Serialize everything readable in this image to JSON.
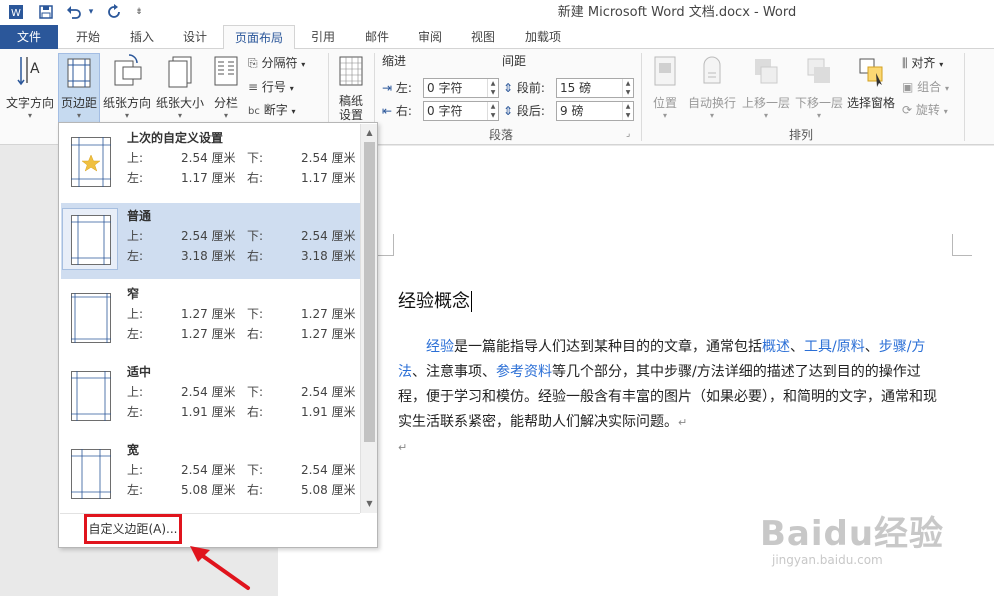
{
  "window": {
    "title": "新建 Microsoft Word 文档.docx - Word",
    "quick_access": [
      "word-icon",
      "save-icon",
      "undo-icon",
      "undo-dropdown-icon",
      "redo-icon",
      "customize-icon"
    ]
  },
  "tabs": [
    "文件",
    "开始",
    "插入",
    "设计",
    "页面布局",
    "引用",
    "邮件",
    "审阅",
    "视图",
    "加载项"
  ],
  "active_tab": "页面布局",
  "ribbon": {
    "text_direction": "文字方向",
    "margins": "页边距",
    "orientation": "纸张方向",
    "size": "纸张大小",
    "columns": "分栏",
    "breaks": "分隔符",
    "line_numbers": "行号",
    "hyphenation": "断字",
    "manuscript": "稿纸\n设置",
    "manuscript_l1": "稿纸",
    "manuscript_l2": "设置",
    "indent_label": "缩进",
    "indent_left_label": "左:",
    "indent_left_value": "0 字符",
    "indent_right_label": "右:",
    "indent_right_value": "0 字符",
    "spacing_label": "间距",
    "spacing_before_label": "段前:",
    "spacing_before_value": "15 磅",
    "spacing_after_label": "段后:",
    "spacing_after_value": "9 磅",
    "paragraph_group": "段落",
    "position": "位置",
    "wrap_text": "自动换行",
    "bring_forward": "上移一层",
    "send_backward": "下移一层",
    "selection_pane": "选择窗格",
    "align": "对齐",
    "group": "组合",
    "rotate": "旋转",
    "arrange_group": "排列"
  },
  "margin_gallery": {
    "options": [
      {
        "name": "上次的自定义设置",
        "top": "2.54 厘米",
        "bottom": "2.54 厘米",
        "left": "1.17 厘米",
        "right": "1.17 厘米",
        "selected": false
      },
      {
        "name": "普通",
        "top": "2.54 厘米",
        "bottom": "2.54 厘米",
        "left": "3.18 厘米",
        "right": "3.18 厘米",
        "selected": true
      },
      {
        "name": "窄",
        "top": "1.27 厘米",
        "bottom": "1.27 厘米",
        "left": "1.27 厘米",
        "right": "1.27 厘米",
        "selected": false
      },
      {
        "name": "适中",
        "top": "2.54 厘米",
        "bottom": "2.54 厘米",
        "left": "1.91 厘米",
        "right": "1.91 厘米",
        "selected": false
      },
      {
        "name": "宽",
        "top": "2.54 厘米",
        "bottom": "2.54 厘米",
        "left": "5.08 厘米",
        "right": "5.08 厘米",
        "selected": false
      }
    ],
    "labels": {
      "top": "上:",
      "bottom": "下:",
      "left": "左:",
      "right": "右:"
    },
    "custom_margins": "自定义边距(A)..."
  },
  "document": {
    "title": "经验概念",
    "body_parts": [
      {
        "t": "经验",
        "link": true
      },
      {
        "t": "是一篇能指导人们达到某种目的的文章，通常包括",
        "link": false
      },
      {
        "t": "概述",
        "link": true
      },
      {
        "t": "、",
        "link": false
      },
      {
        "t": "工具/原料",
        "link": true
      },
      {
        "t": "、",
        "link": false
      },
      {
        "t": "步骤/方法",
        "link": true
      },
      {
        "t": "、注意事项、",
        "link": false
      },
      {
        "t": "参考资料",
        "link": true
      },
      {
        "t": "等几个部分，其中步骤/方法详细的描述了达到目的的操作过程，便于学习和模仿。经验一般含有丰富的图片（如果必要），和简明的文字，通常和现实生活联系紧密，能帮助人们解决实际问题。",
        "link": false
      }
    ],
    "paragraph_mark": "↵"
  },
  "watermark": {
    "brand": "Baidu经验",
    "url": "jingyan.baidu.com"
  },
  "colors": {
    "accent": "#2b579a",
    "link": "#2b6fd6",
    "selected_option": "#cfddf0",
    "highlight_box": "#e0141d"
  }
}
